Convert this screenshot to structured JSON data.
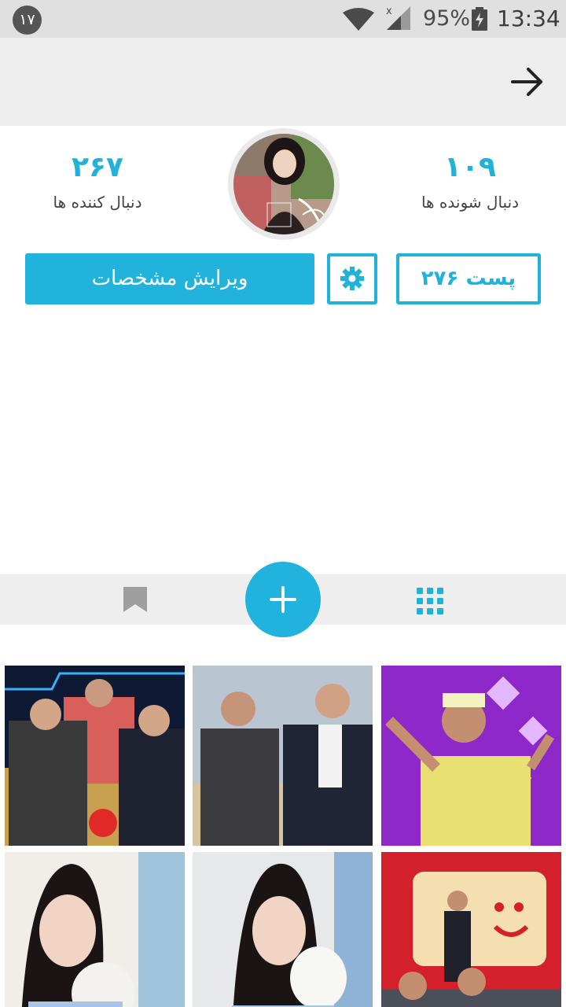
{
  "status_bar": {
    "notification_count": "۱۷",
    "battery_percent": "95%",
    "time": "13:34",
    "icons": [
      "wifi-icon",
      "signal-icon",
      "battery-charging-icon"
    ]
  },
  "app_bar": {
    "back_icon": "arrow-right-icon"
  },
  "profile": {
    "following_count": "۱۰۹",
    "following_label": "دنبال شونده ها",
    "followers_count": "۲۶۷",
    "followers_label": "دنبال کننده ها",
    "posts_button": "۲۷۶ پست",
    "edit_button": "ویرایش مشخصات",
    "settings_icon": "gear-icon"
  },
  "tabs": {
    "grid_icon": "grid-icon",
    "add_icon": "plus-icon",
    "bookmark_icon": "bookmark-icon"
  },
  "posts": [
    {
      "id": "post-1"
    },
    {
      "id": "post-2"
    },
    {
      "id": "post-3"
    },
    {
      "id": "post-4"
    },
    {
      "id": "post-5"
    },
    {
      "id": "post-6"
    }
  ],
  "colors": {
    "accent": "#20b2d9",
    "status_bar_bg": "#e0e0e0",
    "app_bar_bg": "#eeeeee"
  }
}
